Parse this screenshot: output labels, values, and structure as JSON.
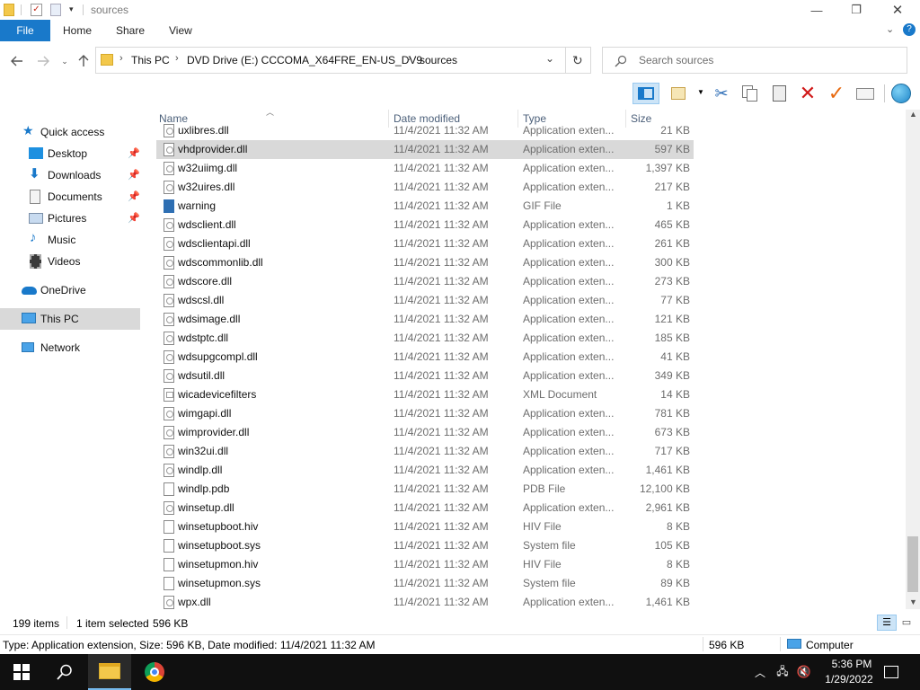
{
  "window": {
    "title": "sources",
    "minimize": "—",
    "maximize": "❐",
    "close": "✕"
  },
  "ribbon": {
    "tabs": [
      "File",
      "Home",
      "Share",
      "View"
    ]
  },
  "address": {
    "crumbs": [
      "This PC",
      "DVD Drive (E:) CCCOMA_X64FRE_EN-US_DV9",
      "sources"
    ]
  },
  "search": {
    "placeholder": "Search sources"
  },
  "sidebar": {
    "items": [
      {
        "label": "Quick access",
        "icon": "star-icon"
      },
      {
        "label": "Desktop",
        "icon": "desktop-icon",
        "pinned": true
      },
      {
        "label": "Downloads",
        "icon": "download-icon",
        "pinned": true
      },
      {
        "label": "Documents",
        "icon": "documents-icon",
        "pinned": true
      },
      {
        "label": "Pictures",
        "icon": "pictures-icon",
        "pinned": true
      },
      {
        "label": "Music",
        "icon": "music-icon"
      },
      {
        "label": "Videos",
        "icon": "videos-icon"
      },
      {
        "label": "OneDrive",
        "icon": "onedrive-icon"
      },
      {
        "label": "This PC",
        "icon": "computer-icon",
        "selected": true
      },
      {
        "label": "Network",
        "icon": "network-icon"
      }
    ]
  },
  "columns": {
    "name": "Name",
    "date": "Date modified",
    "type": "Type",
    "size": "Size"
  },
  "files": [
    {
      "name": "uxlibres.dll",
      "date": "11/4/2021 11:32 AM",
      "type": "Application exten...",
      "size": "21 KB",
      "kind": "dll"
    },
    {
      "name": "vhdprovider.dll",
      "date": "11/4/2021 11:32 AM",
      "type": "Application exten...",
      "size": "597 KB",
      "kind": "dll",
      "selected": true
    },
    {
      "name": "w32uiimg.dll",
      "date": "11/4/2021 11:32 AM",
      "type": "Application exten...",
      "size": "1,397 KB",
      "kind": "dll"
    },
    {
      "name": "w32uires.dll",
      "date": "11/4/2021 11:32 AM",
      "type": "Application exten...",
      "size": "217 KB",
      "kind": "dll"
    },
    {
      "name": "warning",
      "date": "11/4/2021 11:32 AM",
      "type": "GIF File",
      "size": "1 KB",
      "kind": "gif"
    },
    {
      "name": "wdsclient.dll",
      "date": "11/4/2021 11:32 AM",
      "type": "Application exten...",
      "size": "465 KB",
      "kind": "dll"
    },
    {
      "name": "wdsclientapi.dll",
      "date": "11/4/2021 11:32 AM",
      "type": "Application exten...",
      "size": "261 KB",
      "kind": "dll"
    },
    {
      "name": "wdscommonlib.dll",
      "date": "11/4/2021 11:32 AM",
      "type": "Application exten...",
      "size": "300 KB",
      "kind": "dll"
    },
    {
      "name": "wdscore.dll",
      "date": "11/4/2021 11:32 AM",
      "type": "Application exten...",
      "size": "273 KB",
      "kind": "dll"
    },
    {
      "name": "wdscsl.dll",
      "date": "11/4/2021 11:32 AM",
      "type": "Application exten...",
      "size": "77 KB",
      "kind": "dll"
    },
    {
      "name": "wdsimage.dll",
      "date": "11/4/2021 11:32 AM",
      "type": "Application exten...",
      "size": "121 KB",
      "kind": "dll"
    },
    {
      "name": "wdstptc.dll",
      "date": "11/4/2021 11:32 AM",
      "type": "Application exten...",
      "size": "185 KB",
      "kind": "dll"
    },
    {
      "name": "wdsupgcompl.dll",
      "date": "11/4/2021 11:32 AM",
      "type": "Application exten...",
      "size": "41 KB",
      "kind": "dll"
    },
    {
      "name": "wdsutil.dll",
      "date": "11/4/2021 11:32 AM",
      "type": "Application exten...",
      "size": "349 KB",
      "kind": "dll"
    },
    {
      "name": "wicadevicefilters",
      "date": "11/4/2021 11:32 AM",
      "type": "XML Document",
      "size": "14 KB",
      "kind": "xml"
    },
    {
      "name": "wimgapi.dll",
      "date": "11/4/2021 11:32 AM",
      "type": "Application exten...",
      "size": "781 KB",
      "kind": "dll"
    },
    {
      "name": "wimprovider.dll",
      "date": "11/4/2021 11:32 AM",
      "type": "Application exten...",
      "size": "673 KB",
      "kind": "dll"
    },
    {
      "name": "win32ui.dll",
      "date": "11/4/2021 11:32 AM",
      "type": "Application exten...",
      "size": "717 KB",
      "kind": "dll"
    },
    {
      "name": "windlp.dll",
      "date": "11/4/2021 11:32 AM",
      "type": "Application exten...",
      "size": "1,461 KB",
      "kind": "dll"
    },
    {
      "name": "windlp.pdb",
      "date": "11/4/2021 11:32 AM",
      "type": "PDB File",
      "size": "12,100 KB",
      "kind": "plain"
    },
    {
      "name": "winsetup.dll",
      "date": "11/4/2021 11:32 AM",
      "type": "Application exten...",
      "size": "2,961 KB",
      "kind": "dll"
    },
    {
      "name": "winsetupboot.hiv",
      "date": "11/4/2021 11:32 AM",
      "type": "HIV File",
      "size": "8 KB",
      "kind": "plain"
    },
    {
      "name": "winsetupboot.sys",
      "date": "11/4/2021 11:32 AM",
      "type": "System file",
      "size": "105 KB",
      "kind": "plain"
    },
    {
      "name": "winsetupmon.hiv",
      "date": "11/4/2021 11:32 AM",
      "type": "HIV File",
      "size": "8 KB",
      "kind": "plain"
    },
    {
      "name": "winsetupmon.sys",
      "date": "11/4/2021 11:32 AM",
      "type": "System file",
      "size": "89 KB",
      "kind": "plain"
    },
    {
      "name": "wpx.dll",
      "date": "11/4/2021 11:32 AM",
      "type": "Application exten...",
      "size": "1,461 KB",
      "kind": "dll"
    }
  ],
  "status": {
    "item_count": "199 items",
    "selection": "1 item selected",
    "selection_size": "596 KB"
  },
  "details": {
    "text": "Type: Application extension, Size: 596 KB, Date modified: 11/4/2021 11:32 AM",
    "size": "596 KB",
    "location": "Computer"
  },
  "taskbar": {
    "time": "5:36 PM",
    "date": "1/29/2022"
  },
  "colors": {
    "file_tab": "#1979ca",
    "selection": "#d9d9d9",
    "taskbar": "#101010"
  }
}
